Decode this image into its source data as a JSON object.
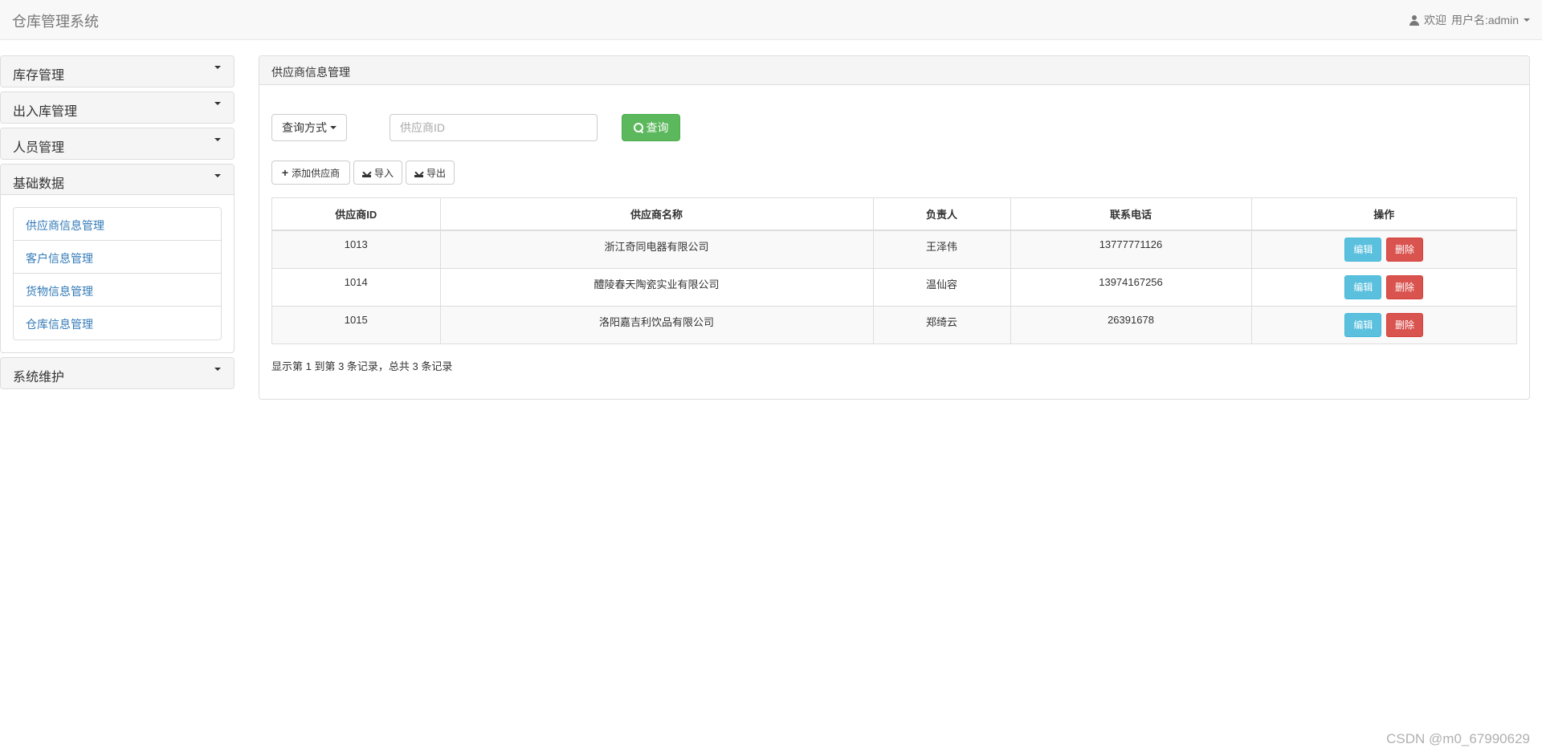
{
  "app": {
    "title": "仓库管理系统"
  },
  "user_menu": {
    "welcome": "欢迎",
    "username": "用户名:admin"
  },
  "sidebar": {
    "sections": [
      {
        "label": "库存管理"
      },
      {
        "label": "出入库管理"
      },
      {
        "label": "人员管理"
      },
      {
        "label": "基础数据",
        "items": [
          "供应商信息管理",
          "客户信息管理",
          "货物信息管理",
          "仓库信息管理"
        ]
      },
      {
        "label": "系统维护"
      }
    ]
  },
  "main": {
    "heading": "供应商信息管理",
    "query_mode_label": "查询方式",
    "search_placeholder": "供应商ID",
    "search_button": "查询",
    "add_button": "添加供应商",
    "import_button": "导入",
    "export_button": "导出",
    "table": {
      "headers": [
        "供应商ID",
        "供应商名称",
        "负责人",
        "联系电话",
        "操作"
      ],
      "rows": [
        {
          "id": "1013",
          "name": "浙江奇同电器有限公司",
          "manager": "王泽伟",
          "phone": "13777771126"
        },
        {
          "id": "1014",
          "name": "醴陵春天陶瓷实业有限公司",
          "manager": "温仙容",
          "phone": "13974167256"
        },
        {
          "id": "1015",
          "name": "洛阳嘉吉利饮品有限公司",
          "manager": "郑绮云",
          "phone": "26391678"
        }
      ],
      "edit_label": "编辑",
      "delete_label": "删除"
    },
    "pagination_info": "显示第 1 到第 3 条记录，总共 3 条记录"
  },
  "watermark": "CSDN @m0_67990629",
  "colors": {
    "success": "#5cb85c",
    "info": "#5bc0de",
    "danger": "#d9534f",
    "link": "#337ab7"
  }
}
